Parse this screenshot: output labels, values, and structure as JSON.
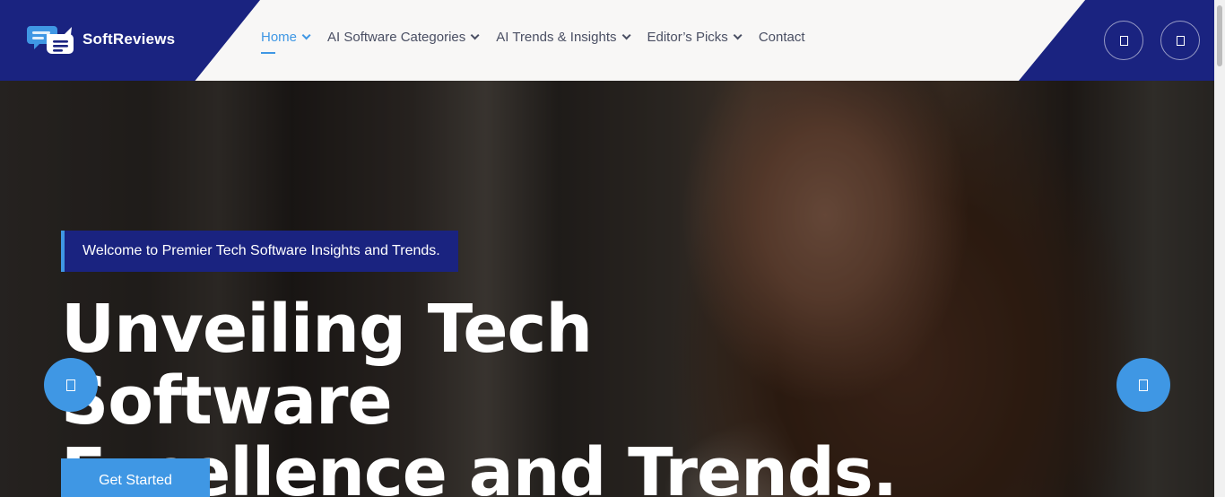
{
  "brand": {
    "name": "SoftReviews",
    "logo_icon": "chat-bubbles-icon"
  },
  "nav": {
    "items": [
      {
        "label": "Home",
        "active": true,
        "has_dropdown": true
      },
      {
        "label": "AI Software Categories",
        "active": false,
        "has_dropdown": true
      },
      {
        "label": "AI Trends & Insights",
        "active": false,
        "has_dropdown": true
      },
      {
        "label": "Editor’s Picks",
        "active": false,
        "has_dropdown": true
      },
      {
        "label": "Contact",
        "active": false,
        "has_dropdown": false
      }
    ]
  },
  "header_actions": [
    {
      "icon": "search-icon"
    },
    {
      "icon": "menu-icon"
    }
  ],
  "hero": {
    "tagline": "Welcome to Premier Tech Software Insights and Trends.",
    "headline_line1": "Unveiling Tech Software",
    "headline_line2": "Excellence and Trends.",
    "cta_label": "Get Started",
    "prev_icon": "arrow-left-icon",
    "next_icon": "arrow-right-icon"
  },
  "colors": {
    "primary_navy": "#1a2380",
    "accent_blue": "#3f97e4",
    "header_bg": "#f8f7f6",
    "nav_text": "#4a4f63"
  }
}
